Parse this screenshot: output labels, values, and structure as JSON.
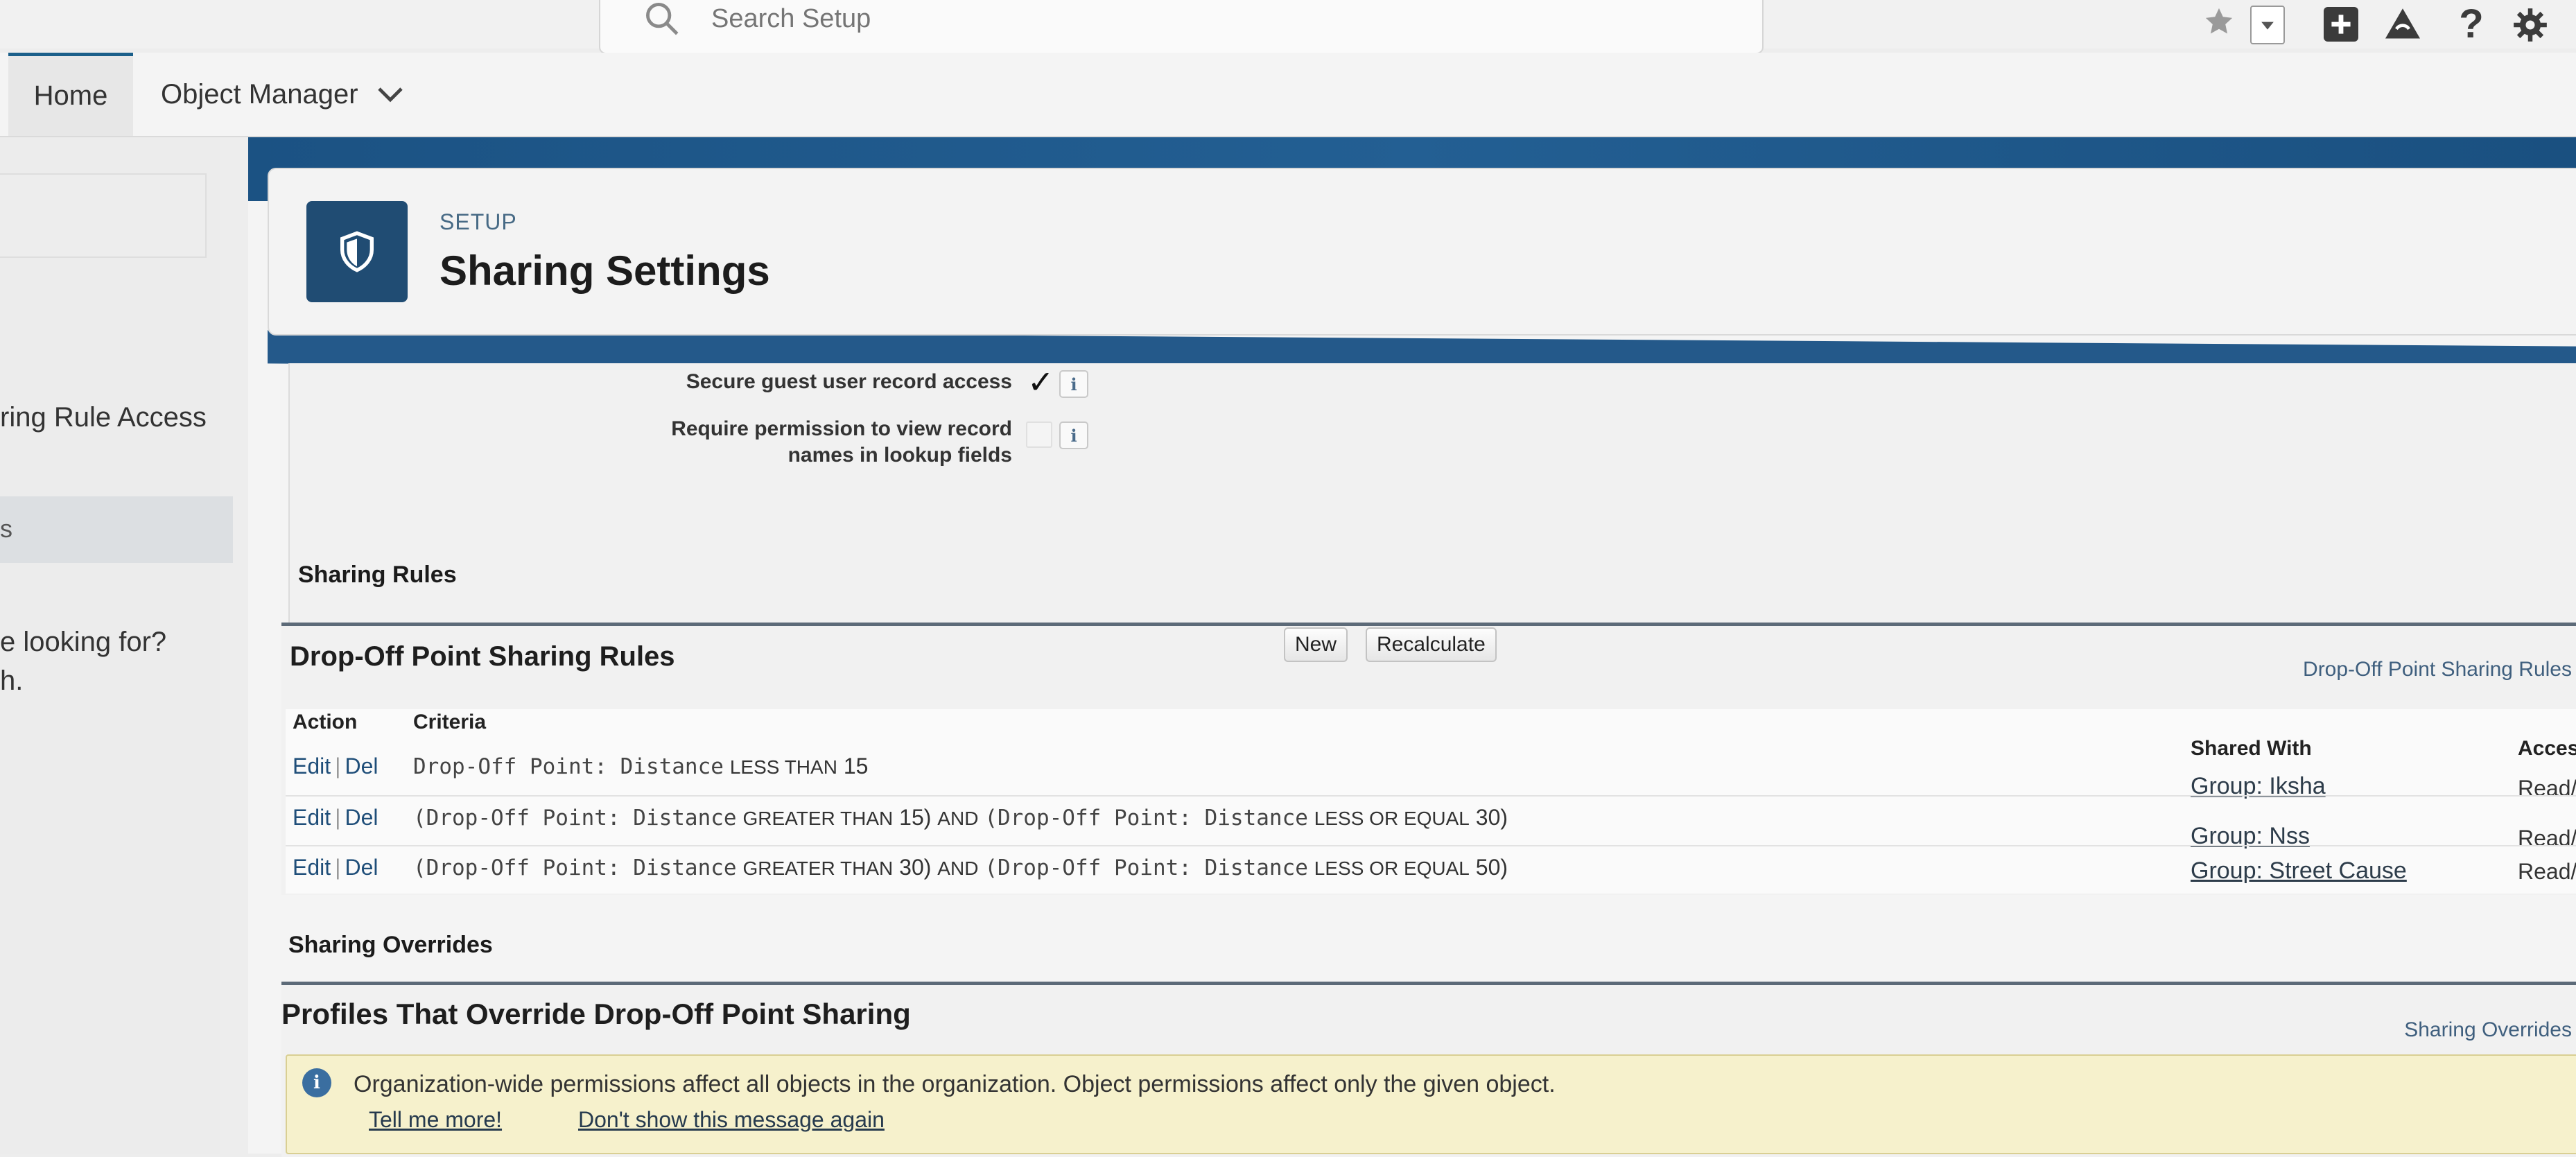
{
  "header": {
    "search_placeholder": "Search Setup"
  },
  "nav": {
    "home": "Home",
    "object_manager": "Object Manager"
  },
  "sidebar": {
    "item_rule_access": "ring Rule Access",
    "item_s": "s",
    "looking_for": "e looking for?",
    "looking_for_2": "h."
  },
  "page": {
    "setup_label": "SETUP",
    "title": "Sharing Settings"
  },
  "settings": {
    "secure_guest_label": "Secure guest user record access",
    "secure_guest_checked": true,
    "secure_guest_mark": "✓",
    "require_perm_label_1": "Require permission to view record",
    "require_perm_label_2": "names in lookup fields",
    "require_perm_checked": false,
    "info_glyph": "i"
  },
  "sharing_rules": {
    "section_label": "Sharing Rules",
    "title": "Drop-Off Point Sharing Rules",
    "new_button": "New",
    "recalculate_button": "Recalculate",
    "help_link": "Drop-Off Point Sharing Rules",
    "columns": {
      "action": "Action",
      "criteria": "Criteria",
      "shared_with": "Shared With",
      "access": "Access L"
    },
    "edit_label": "Edit",
    "del_label": "Del",
    "rows": [
      {
        "c1_prefix": "Drop-Off Point: Distance",
        "c1_op": "LESS THAN",
        "c1_val": "15",
        "shared_with": "Group: Iksha",
        "access": "Read/Wr"
      },
      {
        "c1_prefix": "(Drop-Off Point: Distance",
        "c1_op": "GREATER THAN",
        "c1_val": "15)",
        "and": "AND",
        "c2_prefix": "(Drop-Off Point: Distance",
        "c2_op": "LESS OR EQUAL",
        "c2_val": "30)",
        "shared_with": "Group: Nss",
        "access": "Read/Wr"
      },
      {
        "c1_prefix": "(Drop-Off Point: Distance",
        "c1_op": "GREATER THAN",
        "c1_val": "30)",
        "and": "AND",
        "c2_prefix": "(Drop-Off Point: Distance",
        "c2_op": "LESS OR EQUAL",
        "c2_val": "50)",
        "shared_with": "Group: Street Cause",
        "access": "Read/Wr"
      }
    ]
  },
  "overrides": {
    "section_label": "Sharing Overrides",
    "title": "Profiles That Override Drop-Off Point Sharing",
    "help_link": "Sharing Overrides",
    "info_glyph": "i",
    "message": "Organization-wide permissions affect all objects in the organization. Object permissions affect only the given object.",
    "tell_me_more": "Tell me more!",
    "dont_show": "Don't show this message again"
  }
}
